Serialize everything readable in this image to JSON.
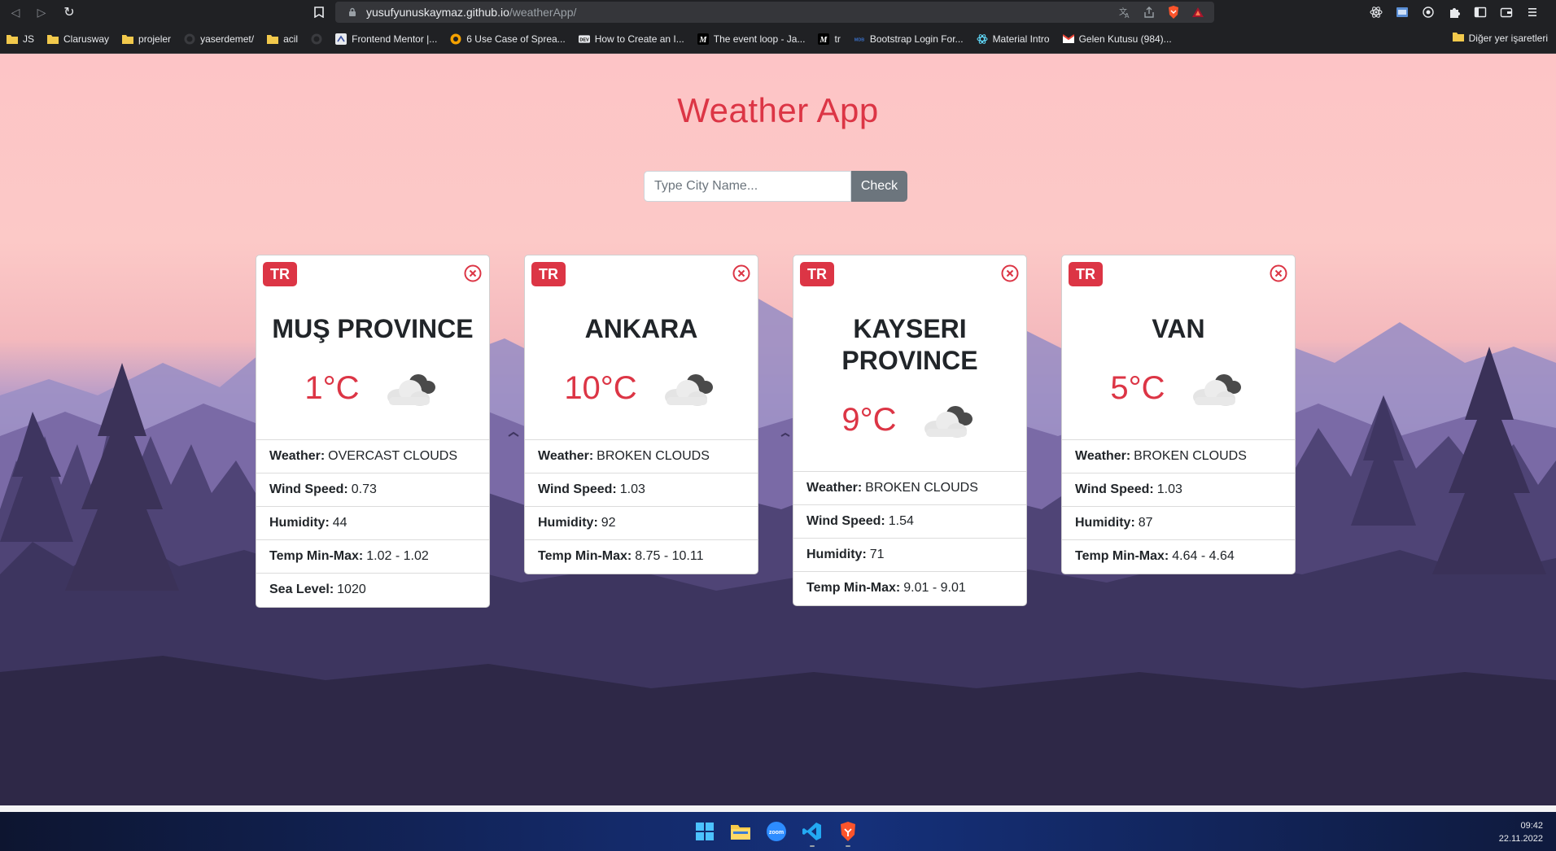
{
  "browser": {
    "url_host": "yusufyunuskaymaz.github.io",
    "url_path": "/weatherApp/",
    "bookmarks": [
      {
        "label": "JS",
        "icon": "folder-icon"
      },
      {
        "label": "Clarusway",
        "icon": "folder-icon"
      },
      {
        "label": "projeler",
        "icon": "folder-icon"
      },
      {
        "label": "yaserdemet/",
        "icon": "github-icon"
      },
      {
        "label": "acil",
        "icon": "folder-icon"
      },
      {
        "label": "",
        "icon": "github-icon"
      },
      {
        "label": "Frontend Mentor |...",
        "icon": "frontend-mentor-icon"
      },
      {
        "label": "6 Use Case of Sprea...",
        "icon": "site-icon"
      },
      {
        "label": "How to Create an I...",
        "icon": "dev-icon"
      },
      {
        "label": "The event loop - Ja...",
        "icon": "medium-icon"
      },
      {
        "label": "tr",
        "icon": "medium-icon"
      },
      {
        "label": "Bootstrap Login For...",
        "icon": "mdb-icon"
      },
      {
        "label": "Material Intro",
        "icon": "react-icon"
      },
      {
        "label": "Gelen Kutusu (984)...",
        "icon": "gmail-icon"
      }
    ],
    "other_bookmarks": "Diğer yer işaretleri"
  },
  "app": {
    "title": "Weather App",
    "search_placeholder": "Type City Name...",
    "check_label": "Check"
  },
  "cards": [
    {
      "country": "TR",
      "city": "MUŞ PROVINCE",
      "temp": "1°C",
      "weather_icon": "broken-clouds-icon",
      "details": [
        {
          "key": "Weather:",
          "value": "OVERCAST CLOUDS"
        },
        {
          "key": "Wind Speed:",
          "value": "0.73"
        },
        {
          "key": "Humidity:",
          "value": "44"
        },
        {
          "key": "Temp Min-Max:",
          "value": "1.02 - 1.02"
        },
        {
          "key": "Sea Level:",
          "value": "1020"
        }
      ]
    },
    {
      "country": "TR",
      "city": "ANKARA",
      "temp": "10°C",
      "weather_icon": "broken-clouds-icon",
      "details": [
        {
          "key": "Weather:",
          "value": "BROKEN CLOUDS"
        },
        {
          "key": "Wind Speed:",
          "value": "1.03"
        },
        {
          "key": "Humidity:",
          "value": "92"
        },
        {
          "key": "Temp Min-Max:",
          "value": "8.75 - 10.11"
        }
      ]
    },
    {
      "country": "TR",
      "city": "KAYSERI PROVINCE",
      "temp": "9°C",
      "weather_icon": "broken-clouds-icon",
      "details": [
        {
          "key": "Weather:",
          "value": "BROKEN CLOUDS"
        },
        {
          "key": "Wind Speed:",
          "value": "1.54"
        },
        {
          "key": "Humidity:",
          "value": "71"
        },
        {
          "key": "Temp Min-Max:",
          "value": "9.01 - 9.01"
        }
      ]
    },
    {
      "country": "TR",
      "city": "VAN",
      "temp": "5°C",
      "weather_icon": "broken-clouds-icon",
      "details": [
        {
          "key": "Weather:",
          "value": "BROKEN CLOUDS"
        },
        {
          "key": "Wind Speed:",
          "value": "1.03"
        },
        {
          "key": "Humidity:",
          "value": "87"
        },
        {
          "key": "Temp Min-Max:",
          "value": "4.64 - 4.64"
        }
      ]
    }
  ],
  "taskbar": {
    "icons": [
      "windows-start-icon",
      "file-explorer-icon",
      "zoom-icon",
      "vscode-icon",
      "brave-icon"
    ],
    "time": "09:42",
    "date": "22.11.2022"
  },
  "colors": {
    "accent": "#dc3545",
    "check_button": "#6c757d",
    "title": "#dc3545"
  }
}
